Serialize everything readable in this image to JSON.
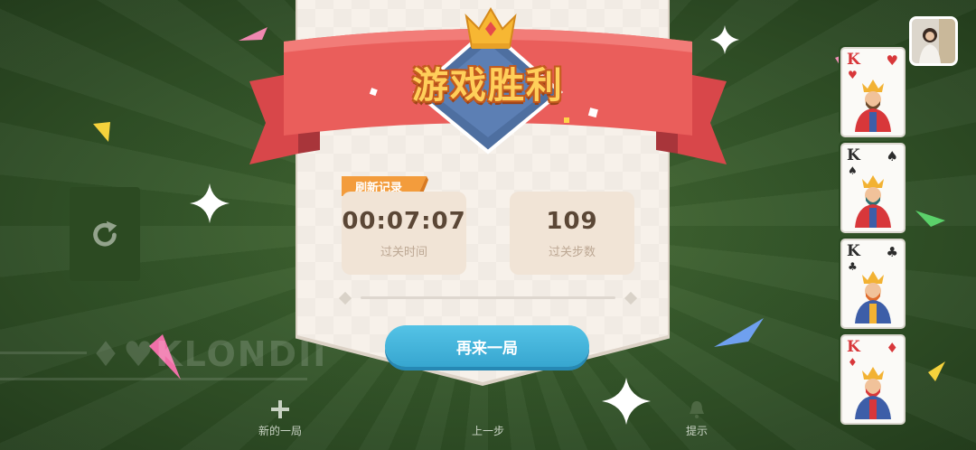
{
  "dialog": {
    "title": "游戏胜利",
    "record_badge": "刷新记录",
    "time_value": "00:07:07",
    "time_label": "过关时间",
    "moves_value": "109",
    "moves_label": "过关步数",
    "play_again_label": "再来一局"
  },
  "background": {
    "brand_text": "♦♥KLONDII"
  },
  "toolbar": {
    "new_game_label": "新的一局",
    "undo_label": "上一步",
    "hint_label": "提示"
  },
  "foundation": {
    "cards": [
      {
        "rank": "K",
        "suit": "♥",
        "color": "red"
      },
      {
        "rank": "K",
        "suit": "♠",
        "color": "black"
      },
      {
        "rank": "K",
        "suit": "♣",
        "color": "black"
      },
      {
        "rank": "K",
        "suit": "♦",
        "color": "red"
      }
    ]
  },
  "colors": {
    "felt": "#35572a",
    "ribbon": "#e85a56",
    "button": "#3fb1da",
    "title_gold": "#ffcf5a"
  }
}
